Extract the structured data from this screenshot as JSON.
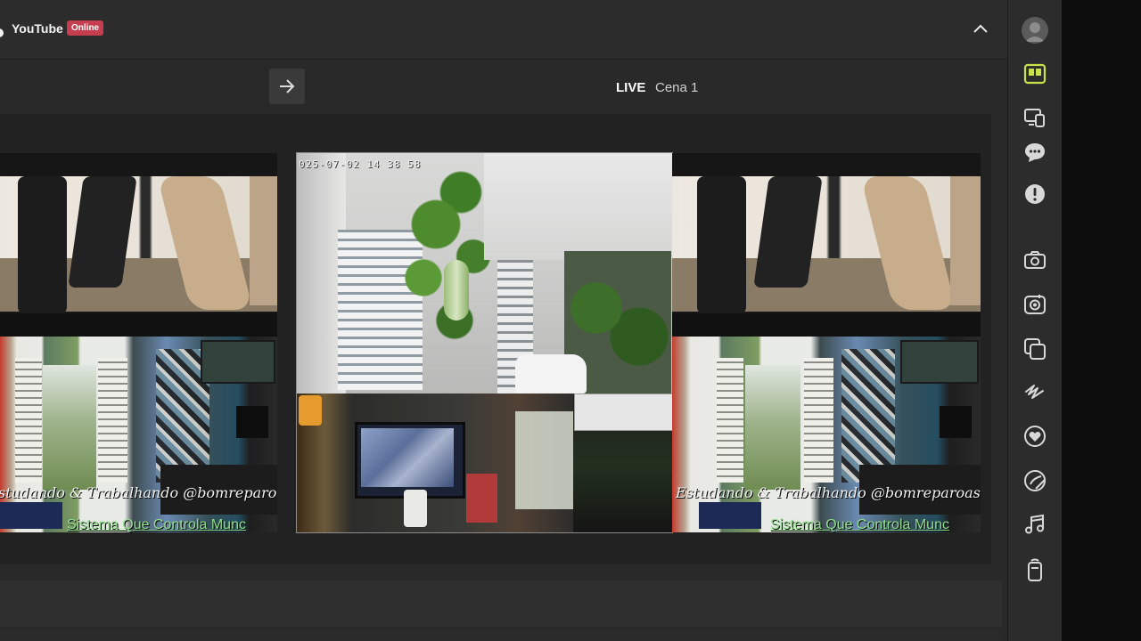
{
  "header": {
    "app_name": "YouTube",
    "status_badge": "Online"
  },
  "toolbar": {
    "live_label": "LIVE",
    "scene_name": "Cena 1"
  },
  "preview": {
    "timestamp": "025-07-02 14 38 58",
    "left_caption": "studando & Trabalhando @bomreparoassistenc",
    "left_banner": "Sistema Que Controla Munc",
    "right_caption": "Estudando & Trabalhando @bomreparoassistenc",
    "right_banner": "Sistema Que Controla Munc"
  },
  "sidebar": {
    "icons": [
      "avatar-icon",
      "layout-icon",
      "devices-icon",
      "chat-icon",
      "alert-icon",
      "camera-icon",
      "snapshot-icon",
      "layers-icon",
      "draw-icon",
      "heart-icon",
      "sticker-icon",
      "music-icon",
      "remote-icon"
    ]
  },
  "colors": {
    "accent": "#c8e24a",
    "badge": "#c53d4f",
    "banner_text": "#8fe08a"
  }
}
